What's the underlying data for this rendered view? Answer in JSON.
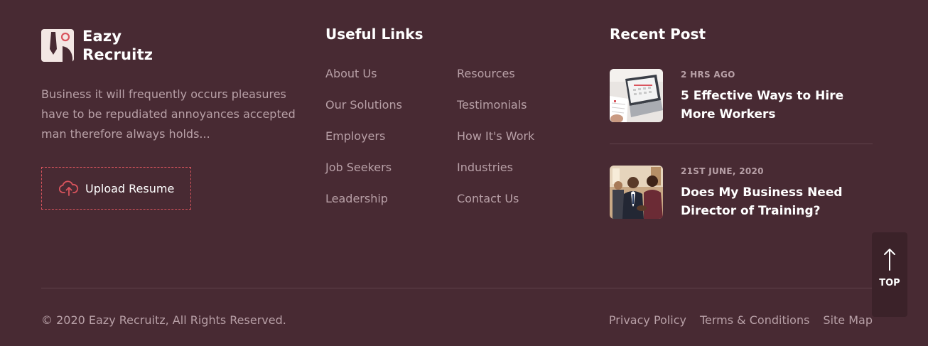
{
  "brand": {
    "name_line1": "Eazy",
    "name_line2": "Recruitz",
    "logo_icon": "briefcase-tie-logo-icon",
    "description": "Business it will frequently occurs pleasures have to be repudiated annoyances accepted man therefore always holds...",
    "upload_label": "Upload Resume",
    "upload_icon": "cloud-upload-icon"
  },
  "useful_links": {
    "title": "Useful Links",
    "column1": [
      "About Us",
      "Our Solutions",
      "Employers",
      "Job Seekers",
      "Leadership"
    ],
    "column2": [
      "Resources",
      "Testimonials",
      "How It's Work",
      "Industries",
      "Contact Us"
    ]
  },
  "recent_posts": {
    "title": "Recent Post",
    "posts": [
      {
        "date": "2 HRS AGO",
        "title": "5 Effective Ways to Hire More Workers",
        "thumb": "laptop-calendar-photo"
      },
      {
        "date": "21ST JUNE, 2020",
        "title": "Does My Business Need Director of Training?",
        "thumb": "business-handshake-photo"
      }
    ]
  },
  "footer": {
    "copyright": "© 2020 Eazy Recruitz, All Rights Reserved.",
    "links": [
      "Privacy Policy",
      "Terms & Conditions",
      "Site Map"
    ]
  },
  "back_to_top": {
    "label": "TOP",
    "icon": "arrow-up-icon"
  },
  "colors": {
    "background": "#482a33",
    "muted_text": "#b8a0a7",
    "accent": "#d9545d",
    "divider": "#5e424a"
  }
}
